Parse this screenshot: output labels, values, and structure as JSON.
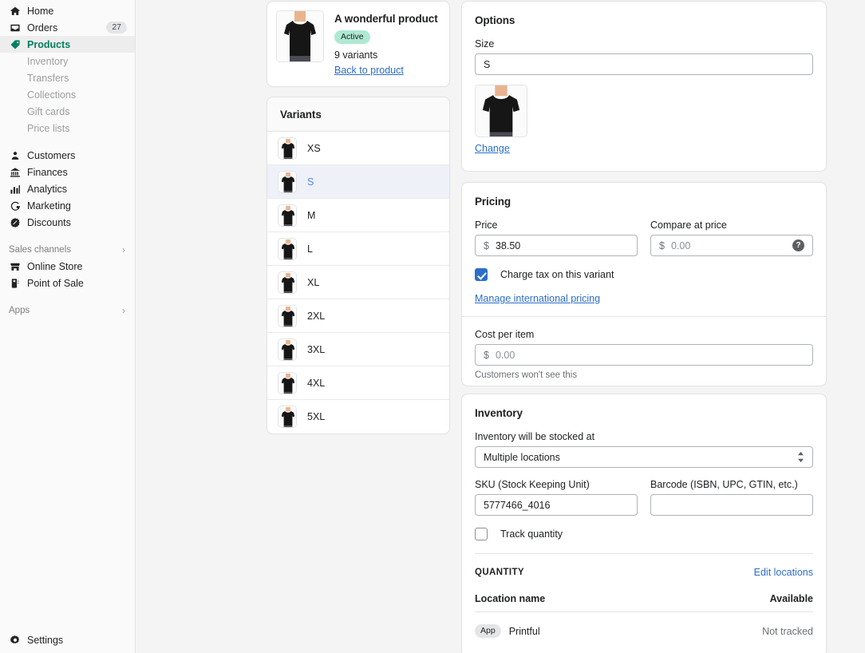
{
  "sidebar": {
    "items": [
      {
        "label": "Home",
        "icon": "home-icon",
        "badge": null,
        "active": false
      },
      {
        "label": "Orders",
        "icon": "orders-icon",
        "badge": "27",
        "active": false
      },
      {
        "label": "Products",
        "icon": "products-tag-icon",
        "badge": null,
        "active": true
      }
    ],
    "sub_items": [
      {
        "label": "Inventory"
      },
      {
        "label": "Transfers"
      },
      {
        "label": "Collections"
      },
      {
        "label": "Gift cards"
      },
      {
        "label": "Price lists"
      }
    ],
    "items2": [
      {
        "label": "Customers",
        "icon": "customers-person-icon"
      },
      {
        "label": "Finances",
        "icon": "finances-bank-icon"
      },
      {
        "label": "Analytics",
        "icon": "analytics-bar-chart-icon"
      },
      {
        "label": "Marketing",
        "icon": "marketing-target-icon"
      },
      {
        "label": "Discounts",
        "icon": "discounts-tag-icon"
      }
    ],
    "sales_channels_label": "Sales channels",
    "channels": [
      {
        "label": "Online Store",
        "icon": "store-icon"
      },
      {
        "label": "Point of Sale",
        "icon": "point-of-sale-icon"
      }
    ],
    "apps_label": "Apps",
    "settings_label": "Settings",
    "settings_icon": "gear-icon",
    "chevron_icon": "chevron-right-icon",
    "accent_color": "#007f5f"
  },
  "product": {
    "title": "A wonderful product",
    "status_badge": "Active",
    "status_badge_color": "#aee9d1",
    "variants_count": "9 variants",
    "back_link": "Back to product",
    "thumbnail_icon": "product-tshirt-thumbnail"
  },
  "variants": {
    "title": "Variants",
    "items": [
      {
        "label": "XS",
        "selected": false
      },
      {
        "label": "S",
        "selected": true
      },
      {
        "label": "M",
        "selected": false
      },
      {
        "label": "L",
        "selected": false
      },
      {
        "label": "XL",
        "selected": false
      },
      {
        "label": "2XL",
        "selected": false
      },
      {
        "label": "3XL",
        "selected": false
      },
      {
        "label": "4XL",
        "selected": false
      },
      {
        "label": "5XL",
        "selected": false
      }
    ],
    "selected_color": "#4f87e5",
    "selected_bg": "#eef1f8"
  },
  "options": {
    "title": "Options",
    "size_label": "Size",
    "size_value": "S",
    "change_link": "Change",
    "image_icon": "variant-tshirt-image"
  },
  "pricing": {
    "title": "Pricing",
    "price_label": "Price",
    "price_currency": "$",
    "price_value": "38.50",
    "compare_label": "Compare at price",
    "compare_currency": "$",
    "compare_placeholder": "0.00",
    "compare_help_icon": "help-question-icon",
    "charge_tax_label": "Charge tax on this variant",
    "charge_tax_checked": true,
    "international_link": "Manage international pricing",
    "cost_label": "Cost per item",
    "cost_currency": "$",
    "cost_placeholder": "0.00",
    "cost_hint": "Customers won't see this",
    "checkbox_color": "#2c6ecb"
  },
  "inventory": {
    "title": "Inventory",
    "stocked_label": "Inventory will be stocked at",
    "stocked_value": "Multiple locations",
    "stocked_icon": "select-chevrons-icon",
    "sku_label": "SKU (Stock Keeping Unit)",
    "sku_value": "5777466_4016",
    "barcode_label": "Barcode (ISBN, UPC, GTIN, etc.)",
    "barcode_value": "",
    "track_quantity_label": "Track quantity",
    "track_quantity_checked": false,
    "quantity_title": "QUANTITY",
    "edit_locations_link": "Edit locations",
    "col_location": "Location name",
    "col_available": "Available",
    "rows": [
      {
        "badge": "App",
        "name": "Printful",
        "available": "Not tracked"
      }
    ]
  }
}
